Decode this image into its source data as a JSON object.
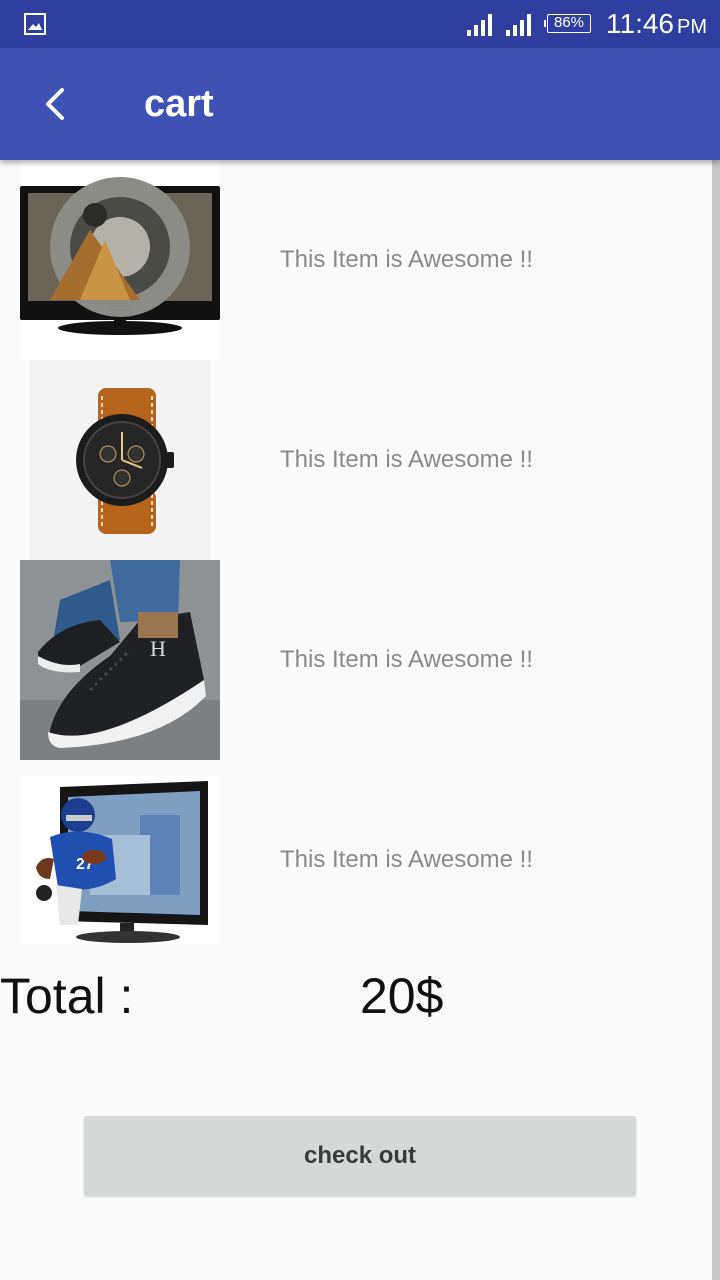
{
  "status_bar": {
    "battery": "86%",
    "time": "11:46",
    "ampm": "PM",
    "icons": [
      "gallery-icon",
      "signal-icon",
      "signal-icon",
      "battery-icon"
    ]
  },
  "app_bar": {
    "back_icon": "back-arrow-icon",
    "title": "cart",
    "color": "#3f51b5"
  },
  "cart": {
    "items": [
      {
        "image": "tv-image",
        "text": "This Item is Awesome !!"
      },
      {
        "image": "watch-image",
        "text": "This Item is Awesome !!"
      },
      {
        "image": "sneaker-image",
        "text": "This Item is Awesome !!"
      },
      {
        "image": "tv-football-image",
        "text": "This Item is Awesome !!"
      }
    ]
  },
  "total": {
    "label": "Total :",
    "value": "20$"
  },
  "checkout": {
    "label": "check out"
  }
}
